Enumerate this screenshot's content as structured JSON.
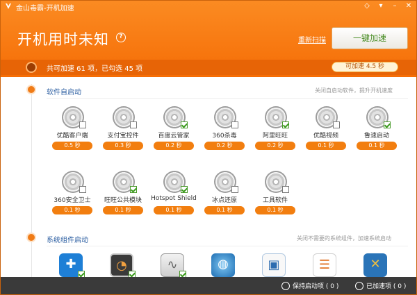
{
  "app": {
    "title": "金山毒霸-开机加速"
  },
  "header": {
    "headline": "开机用时未知",
    "rescan_label": "重新扫描",
    "speedup_label": "一键加速",
    "stat_text": "共可加速 61 项，已勾选 45 项",
    "speed_pill": "可加速 4.5 秒"
  },
  "section1": {
    "title": "软件自启动",
    "hint": "关闭自启动软件，提升开机速度",
    "items": [
      {
        "name": "优酷客户端",
        "time": "0.5 秒",
        "checked": false
      },
      {
        "name": "支付宝控件",
        "time": "0.3 秒",
        "checked": false
      },
      {
        "name": "百度云管家",
        "time": "0.2 秒",
        "checked": true
      },
      {
        "name": "360杀毒",
        "time": "0.2 秒",
        "checked": false
      },
      {
        "name": "阿里旺旺",
        "time": "0.2 秒",
        "checked": true
      },
      {
        "name": "优酷视频",
        "time": "0.1 秒",
        "checked": false
      },
      {
        "name": "鲁速启动",
        "time": "0.1 秒",
        "checked": true
      },
      {
        "name": "360安全卫士",
        "time": "0.1 秒",
        "checked": false
      },
      {
        "name": "旺旺公共模块",
        "time": "0.1 秒",
        "checked": true
      },
      {
        "name": "Hotspot Shield",
        "time": "0.1 秒",
        "checked": true
      },
      {
        "name": "冰点还原",
        "time": "0.1 秒",
        "checked": false
      },
      {
        "name": "工具软件",
        "time": "0.1 秒",
        "checked": false
      }
    ]
  },
  "section2": {
    "title": "系统组件启动",
    "hint": "关闭不需要的系统组件，加速系统启动",
    "icons": [
      "accessibility-icon",
      "gauge-icon",
      "chart-icon",
      "meter-icon",
      "monitor-icon",
      "list-icon",
      "tools-icon"
    ]
  },
  "footer": {
    "keep_label": "保持启动项 ( 0 )",
    "done_label": "已加速项 ( 0 )"
  },
  "colors": {
    "accent": "#f56d06",
    "dark": "#3a3a3a",
    "link": "#2d5fa2"
  }
}
